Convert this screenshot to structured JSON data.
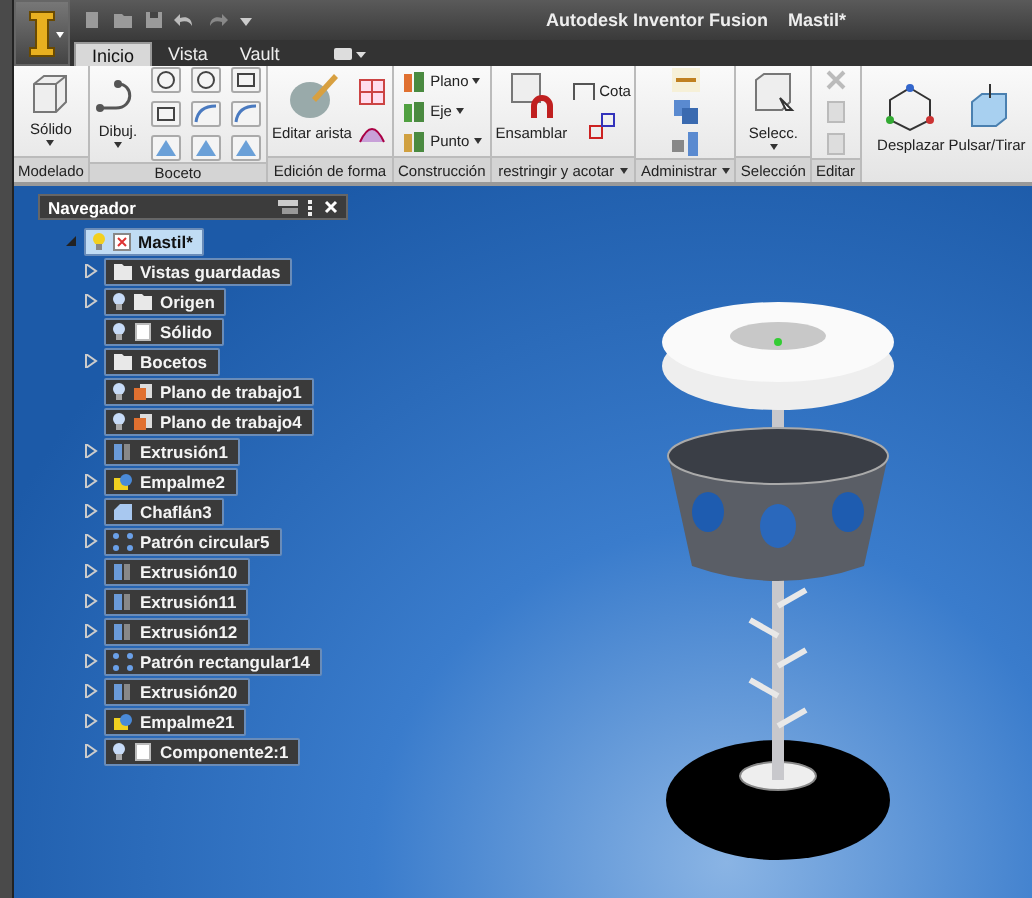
{
  "title": {
    "app": "Autodesk Inventor Fusion",
    "document": "Mastil*"
  },
  "tabs": [
    {
      "label": "Inicio",
      "selected": true
    },
    {
      "label": "Vista",
      "selected": false
    },
    {
      "label": "Vault",
      "selected": false
    }
  ],
  "ribbon": [
    {
      "kind": "modeling",
      "label": "Modelado",
      "menu": false,
      "buttons": [
        {
          "label": "Sólido",
          "dropdown": true
        }
      ]
    },
    {
      "kind": "sketch",
      "label": "Boceto",
      "menu": false,
      "buttons": [
        {
          "label": "Dibuj.",
          "dropdown": true
        }
      ]
    },
    {
      "kind": "shape",
      "label": "Edición de forma",
      "menu": false,
      "buttons": [
        {
          "label": "Editar arista",
          "dropdown": false
        }
      ]
    },
    {
      "kind": "construction",
      "label": "Construcción",
      "menu": false,
      "buttons": [
        {
          "label": "Plano",
          "dropdown": true
        },
        {
          "label": "Eje",
          "dropdown": true
        },
        {
          "label": "Punto",
          "dropdown": true
        }
      ]
    },
    {
      "kind": "constraint",
      "label": "restringir y acotar",
      "menu": true,
      "buttons": [
        {
          "label": "Ensamblar",
          "dropdown": false
        },
        {
          "label": "Cota",
          "dropdown": false
        }
      ]
    },
    {
      "kind": "manage",
      "label": "Administrar",
      "menu": true
    },
    {
      "kind": "selection",
      "label": "Selección",
      "menu": false,
      "buttons": [
        {
          "label": "Selecc.",
          "dropdown": true
        }
      ]
    },
    {
      "kind": "edit",
      "label": "Editar",
      "menu": false
    },
    {
      "kind": "move",
      "buttons": [
        {
          "label": "Desplazar",
          "dropdown": false
        },
        {
          "label": "Pulsar/Tirar",
          "dropdown": false
        }
      ]
    }
  ],
  "navigator": {
    "title": "Navegador",
    "root": {
      "label": "Mastil*",
      "expanded": true,
      "selected": true,
      "bulb": true,
      "kind": "part",
      "children": [
        {
          "label": "Vistas guardadas",
          "expandable": true,
          "bulb": false,
          "kind": "folder"
        },
        {
          "label": "Origen",
          "expandable": true,
          "bulb": true,
          "kind": "folder"
        },
        {
          "label": "Sólido",
          "expandable": false,
          "bulb": true,
          "kind": "solid"
        },
        {
          "label": "Bocetos",
          "expandable": true,
          "bulb": false,
          "kind": "folder"
        },
        {
          "label": "Plano de trabajo1",
          "expandable": false,
          "bulb": true,
          "kind": "plane"
        },
        {
          "label": "Plano de trabajo4",
          "expandable": false,
          "bulb": true,
          "kind": "plane"
        },
        {
          "label": "Extrusión1",
          "expandable": true,
          "bulb": false,
          "kind": "extrusion"
        },
        {
          "label": "Empalme2",
          "expandable": true,
          "bulb": false,
          "kind": "fillet"
        },
        {
          "label": "Chaflán3",
          "expandable": true,
          "bulb": false,
          "kind": "chamfer"
        },
        {
          "label": "Patrón circular5",
          "expandable": true,
          "bulb": false,
          "kind": "pattern"
        },
        {
          "label": "Extrusión10",
          "expandable": true,
          "bulb": false,
          "kind": "extrusion"
        },
        {
          "label": "Extrusión11",
          "expandable": true,
          "bulb": false,
          "kind": "extrusion"
        },
        {
          "label": "Extrusión12",
          "expandable": true,
          "bulb": false,
          "kind": "extrusion"
        },
        {
          "label": "Patrón rectangular14",
          "expandable": true,
          "bulb": false,
          "kind": "pattern"
        },
        {
          "label": "Extrusión20",
          "expandable": true,
          "bulb": false,
          "kind": "extrusion"
        },
        {
          "label": "Empalme21",
          "expandable": true,
          "bulb": false,
          "kind": "fillet"
        },
        {
          "label": "Componente2:1",
          "expandable": true,
          "bulb": true,
          "kind": "solid"
        }
      ]
    }
  }
}
